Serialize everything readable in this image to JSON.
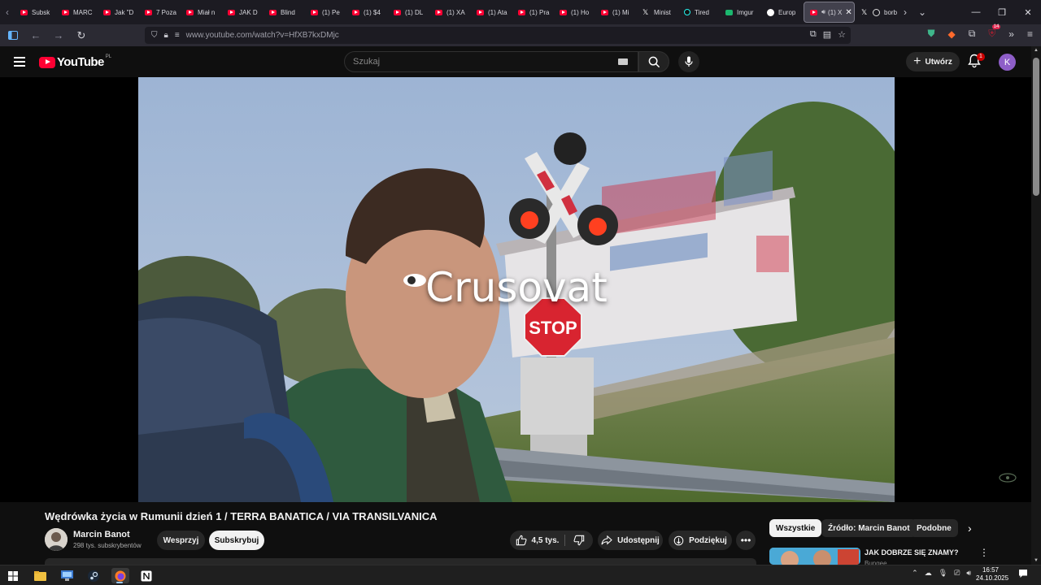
{
  "browser": {
    "tabs": [
      {
        "label": "Subsk",
        "icon": "youtube"
      },
      {
        "label": "MARC",
        "icon": "youtube"
      },
      {
        "label": "Jak \"D",
        "icon": "youtube"
      },
      {
        "label": "7 Poza",
        "icon": "youtube"
      },
      {
        "label": "Miał n",
        "icon": "youtube"
      },
      {
        "label": "JAK D",
        "icon": "youtube"
      },
      {
        "label": "Blind",
        "icon": "youtube"
      },
      {
        "label": "(1) Pe",
        "icon": "youtube"
      },
      {
        "label": "(1) $4",
        "icon": "youtube"
      },
      {
        "label": "(1) DL",
        "icon": "youtube"
      },
      {
        "label": "(1) XA",
        "icon": "youtube"
      },
      {
        "label": "(1) Ata",
        "icon": "youtube"
      },
      {
        "label": "(1) Pra",
        "icon": "youtube"
      },
      {
        "label": "(1) Ho",
        "icon": "youtube"
      },
      {
        "label": "(1) Mi",
        "icon": "youtube"
      },
      {
        "label": "Minist",
        "icon": "x"
      },
      {
        "label": "Tired",
        "icon": "tiktok"
      },
      {
        "label": "Imgur",
        "icon": "imgur"
      },
      {
        "label": "Europ",
        "icon": "globe"
      },
      {
        "label": "(1) X",
        "icon": "youtube",
        "active": true
      },
      {
        "label": "borbe",
        "icon": "x"
      }
    ],
    "url": "www.youtube.com/watch?v=HfXB7kxDMjc"
  },
  "youtube": {
    "logo_text": "YouTube",
    "country_code": "PL",
    "search_placeholder": "Szukaj",
    "create_label": "Utwórz",
    "notification_count": "1",
    "avatar_letter": "K"
  },
  "video": {
    "overlay_title": "Crusovat",
    "title": "Wędrówka życia w Rumunii dzień 1 / TERRA BANATICA / VIA TRANSILVANICA",
    "channel_name": "Marcin Banot",
    "subscribers": "298 tys. subskrybentów",
    "support_label": "Wesprzyj",
    "subscribe_label": "Subskrybuj",
    "likes": "4,5 tys.",
    "share_label": "Udostępnij",
    "thanks_label": "Podziękuj"
  },
  "recommendations": {
    "chips": [
      "Wszystkie",
      "Źródło: Marcin Banot",
      "Podobne"
    ],
    "first_title": "JAK DOBRZE SIĘ ZNAMY?",
    "first_channel": "Bungee"
  },
  "taskbar": {
    "time": "16:57",
    "date": "24.10.2025"
  },
  "colors": {
    "youtube_red": "#ff0033",
    "background": "#0f0f0f",
    "browser_chrome": "#1c1b22"
  }
}
